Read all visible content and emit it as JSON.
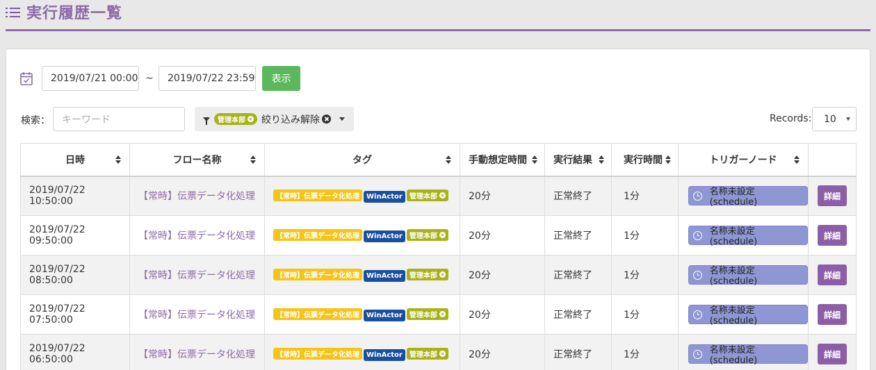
{
  "header": {
    "title": "実行履歴一覧"
  },
  "filters": {
    "date_from": "2019/07/21 00:00",
    "date_separator": "~",
    "date_to": "2019/07/22 23:59",
    "show_button": "表示",
    "search_label": "検索：",
    "search_placeholder": "キーワード",
    "active_tag": "管理本部",
    "clear_filter_label": "絞り込み解除",
    "records_label": "Records:",
    "records_value": "10"
  },
  "table": {
    "columns": [
      "日時",
      "フロー名称",
      "タグ",
      "手動想定時間",
      "実行結果",
      "実行時間",
      "トリガーノード",
      ""
    ],
    "rows": [
      {
        "datetime": "2019/07/22 10:50:00",
        "flow": "【常時】伝票データ化処理",
        "tags": [
          "【常時】伝票データ化処理",
          "WinActor",
          "管理本部"
        ],
        "manual_time": "20分",
        "result": "正常終了",
        "exec_time": "1分",
        "trigger": "名称未設定 (schedule)",
        "detail": "詳細"
      },
      {
        "datetime": "2019/07/22 09:50:00",
        "flow": "【常時】伝票データ化処理",
        "tags": [
          "【常時】伝票データ化処理",
          "WinActor",
          "管理本部"
        ],
        "manual_time": "20分",
        "result": "正常終了",
        "exec_time": "1分",
        "trigger": "名称未設定 (schedule)",
        "detail": "詳細"
      },
      {
        "datetime": "2019/07/22 08:50:00",
        "flow": "【常時】伝票データ化処理",
        "tags": [
          "【常時】伝票データ化処理",
          "WinActor",
          "管理本部"
        ],
        "manual_time": "20分",
        "result": "正常終了",
        "exec_time": "1分",
        "trigger": "名称未設定 (schedule)",
        "detail": "詳細"
      },
      {
        "datetime": "2019/07/22 07:50:00",
        "flow": "【常時】伝票データ化処理",
        "tags": [
          "【常時】伝票データ化処理",
          "WinActor",
          "管理本部"
        ],
        "manual_time": "20分",
        "result": "正常終了",
        "exec_time": "1分",
        "trigger": "名称未設定 (schedule)",
        "detail": "詳細"
      },
      {
        "datetime": "2019/07/22 06:50:00",
        "flow": "【常時】伝票データ化処理",
        "tags": [
          "【常時】伝票データ化処理",
          "WinActor",
          "管理本部"
        ],
        "manual_time": "20分",
        "result": "正常終了",
        "exec_time": "1分",
        "trigger": "名称未設定 (schedule)",
        "detail": "詳細"
      }
    ]
  },
  "colors": {
    "accent": "#8c6aa8",
    "show_button": "#5cb85c",
    "tag_yellow": "#f4c416",
    "tag_blue": "#1a4fa0",
    "tag_green": "#a8b31a",
    "trigger_chip": "#8e97d4",
    "detail_button": "#8c5ea8"
  },
  "icons": {
    "header": "list-icon",
    "date": "calendar-check-icon",
    "filter": "funnel-icon",
    "clear": "times-circle-icon",
    "trigger": "clock-icon",
    "sort": "sort-icon"
  }
}
